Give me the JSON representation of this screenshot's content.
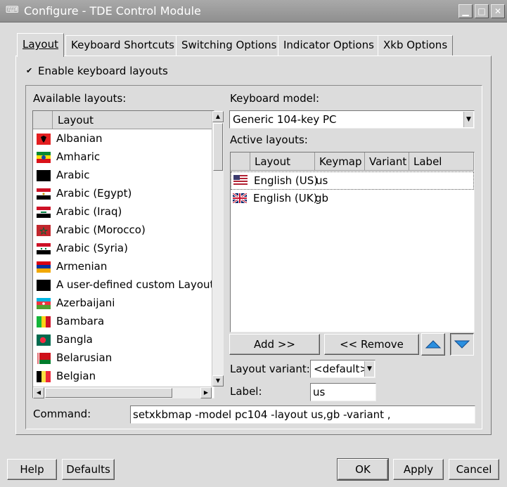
{
  "window": {
    "title": "Configure - TDE Control Module",
    "controls": [
      "minimize-icon",
      "maximize-icon",
      "close-icon"
    ]
  },
  "tabs": [
    {
      "label": "Layout",
      "mnemonic_index": 0,
      "active": true
    },
    {
      "label": "Keyboard Shortcuts",
      "mnemonic_index": 0
    },
    {
      "label": "Switching Options",
      "mnemonic_index": 0
    },
    {
      "label": "Indicator Options",
      "mnemonic_index": 0
    },
    {
      "label": "Xkb Options",
      "mnemonic_index": 0
    }
  ],
  "enable": {
    "label": "Enable keyboard layouts",
    "checked": true
  },
  "available": {
    "label": "Available layouts:",
    "column": "Layout",
    "items": [
      {
        "name": "Albanian",
        "flag": "albania"
      },
      {
        "name": "Amharic",
        "flag": "ethiopia"
      },
      {
        "name": "Arabic",
        "flag": "none"
      },
      {
        "name": "Arabic (Egypt)",
        "flag": "egypt"
      },
      {
        "name": "Arabic (Iraq)",
        "flag": "iraq"
      },
      {
        "name": "Arabic (Morocco)",
        "flag": "morocco"
      },
      {
        "name": "Arabic (Syria)",
        "flag": "syria"
      },
      {
        "name": "Armenian",
        "flag": "armenia"
      },
      {
        "name": "A user-defined custom Layout",
        "flag": "none"
      },
      {
        "name": "Azerbaijani",
        "flag": "azerbaijan"
      },
      {
        "name": "Bambara",
        "flag": "mali"
      },
      {
        "name": "Bangla",
        "flag": "bangladesh"
      },
      {
        "name": "Belarusian",
        "flag": "belarus"
      },
      {
        "name": "Belgian",
        "flag": "belgium"
      }
    ]
  },
  "keyboard_model": {
    "label": "Keyboard model:",
    "value": "Generic 104-key PC"
  },
  "active": {
    "label": "Active layouts:",
    "columns": [
      "Layout",
      "Keymap",
      "Variant",
      "Label"
    ],
    "rows": [
      {
        "layout": "English (US)",
        "keymap": "us",
        "flag": "usa",
        "selected": true
      },
      {
        "layout": "English (UK)",
        "keymap": "gb",
        "flag": "uk",
        "selected": false
      }
    ]
  },
  "buttons": {
    "add": "Add >>",
    "remove": "<< Remove",
    "up_icon": "arrow-up-icon",
    "down_icon": "arrow-down-icon"
  },
  "variant": {
    "label": "Layout variant:",
    "value": "<default>"
  },
  "label_field": {
    "label": "Label:",
    "value": "us"
  },
  "command": {
    "label": "Command:",
    "value": "setxkbmap -model pc104 -layout us,gb -variant ,"
  },
  "footer": {
    "help": "Help",
    "defaults": "Defaults",
    "ok": "OK",
    "apply": "Apply",
    "cancel": "Cancel"
  }
}
